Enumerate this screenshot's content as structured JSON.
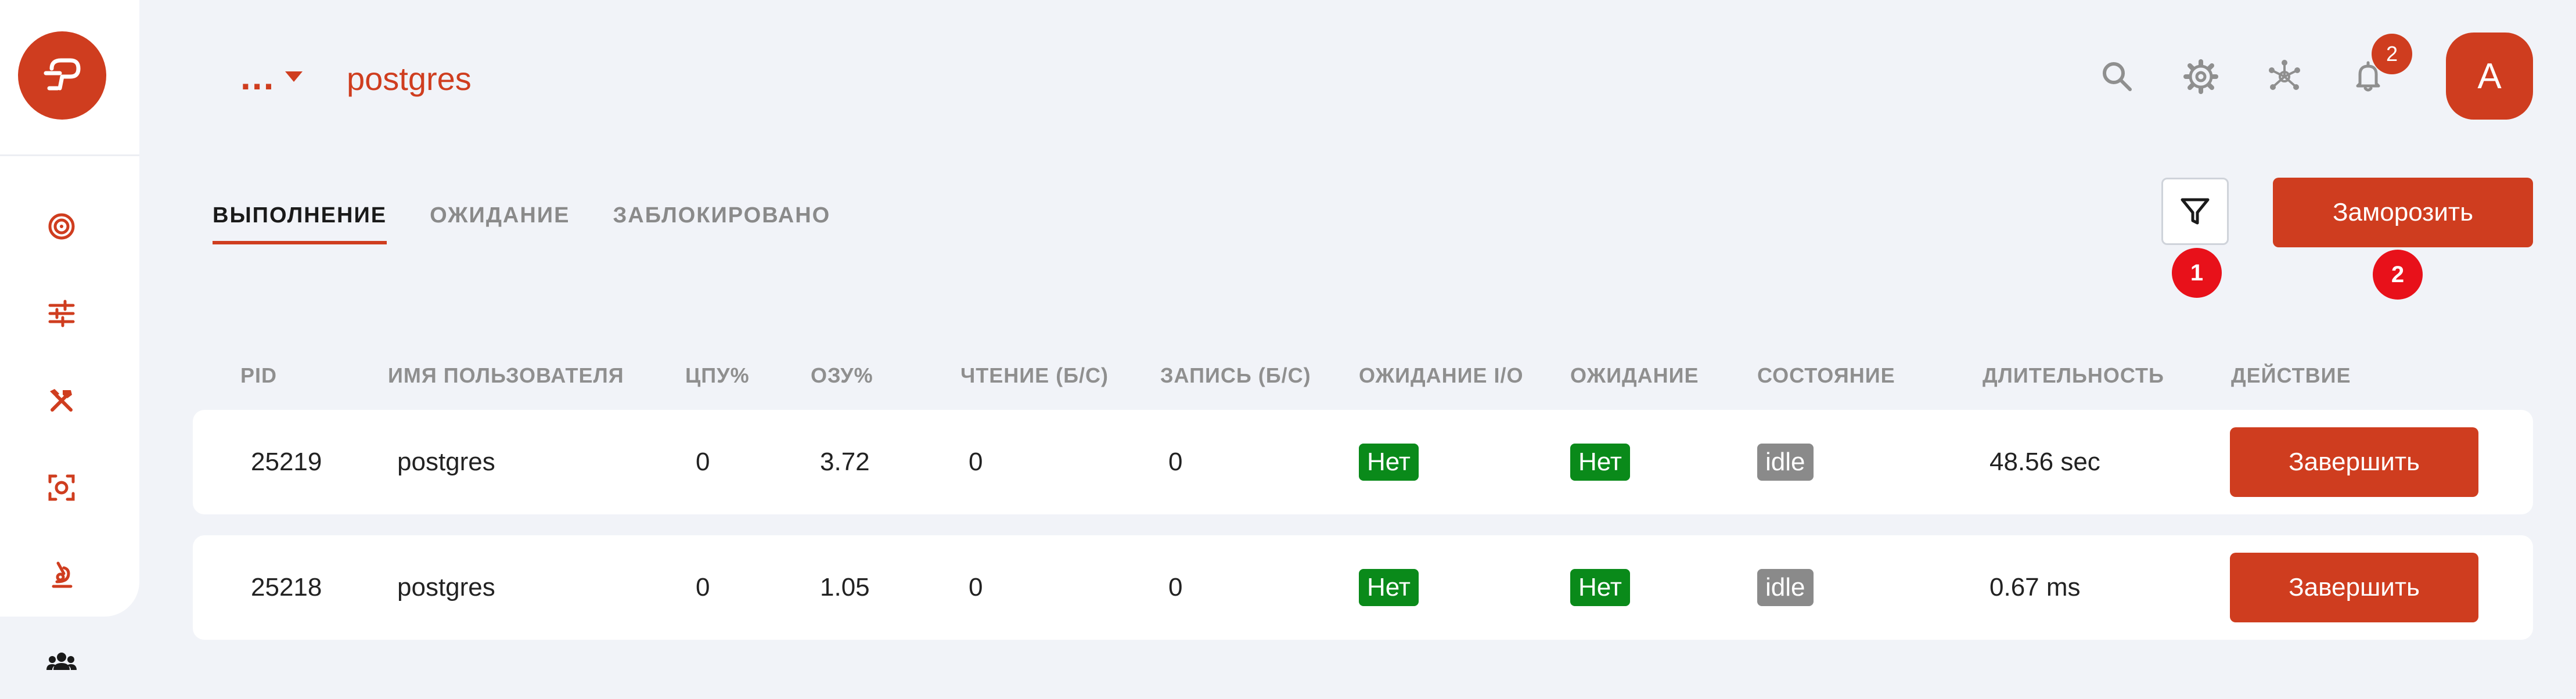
{
  "colors": {
    "accent": "#cf3d1f",
    "background": "#f1f3f8",
    "status_green": "#0a8a1a",
    "status_grey": "#8a8a8a",
    "marker_red": "#e8111a"
  },
  "header": {
    "db_switcher": "...",
    "db_name": "postgres",
    "notifications_count": "2",
    "avatar_initial": "A"
  },
  "sidebar": {
    "items": [
      {
        "icon": "target-icon"
      },
      {
        "icon": "sliders-icon"
      },
      {
        "icon": "tools-icon"
      },
      {
        "icon": "scan-icon"
      },
      {
        "icon": "microscope-icon"
      },
      {
        "icon": "users-icon",
        "active": true
      }
    ]
  },
  "tabs": [
    {
      "label": "ВЫПОЛНЕНИЕ",
      "active": true
    },
    {
      "label": "ОЖИДАНИЕ",
      "active": false
    },
    {
      "label": "ЗАБЛОКИРОВАНО",
      "active": false
    }
  ],
  "toolbar": {
    "freeze_label": "Заморозить",
    "markers": [
      "1",
      "2"
    ]
  },
  "table": {
    "columns": [
      "PID",
      "ИМЯ ПОЛЬЗОВАТЕЛЯ",
      "ЦПУ%",
      "ОЗУ%",
      "ЧТЕНИЕ (Б/С)",
      "ЗАПИСЬ (Б/С)",
      "ОЖИДАНИЕ I/O",
      "ОЖИДАНИЕ",
      "СОСТОЯНИЕ",
      "ДЛИТЕЛЬНОСТЬ",
      "ДЕЙСТВИЕ"
    ],
    "rows": [
      {
        "pid": "25219",
        "user": "postgres",
        "cpu": "0",
        "ram": "3.72",
        "read": "0",
        "write": "0",
        "io_wait": "Нет",
        "wait": "Нет",
        "state": "idle",
        "duration": "48.56 sec",
        "action": "Завершить"
      },
      {
        "pid": "25218",
        "user": "postgres",
        "cpu": "0",
        "ram": "1.05",
        "read": "0",
        "write": "0",
        "io_wait": "Нет",
        "wait": "Нет",
        "state": "idle",
        "duration": "0.67 ms",
        "action": "Завершить"
      }
    ]
  }
}
